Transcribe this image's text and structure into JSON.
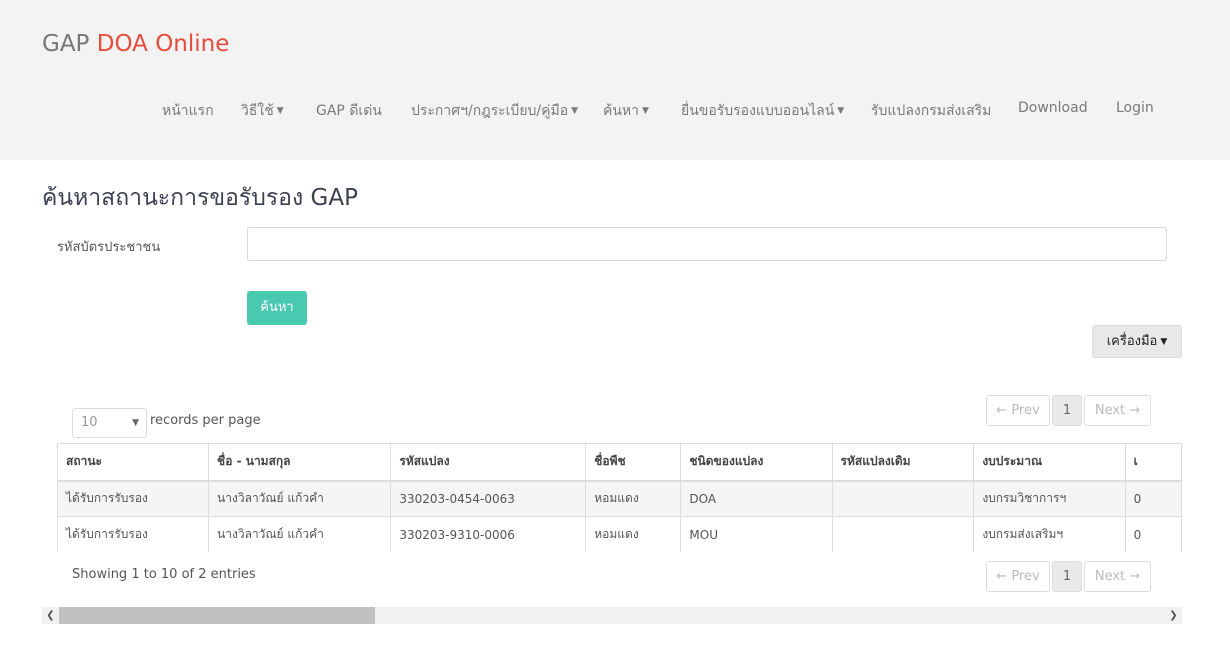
{
  "header": {
    "brand_prefix": "GAP ",
    "brand_accent": "DOA Online",
    "nav": [
      {
        "label": "หน้าแรก",
        "dropdown": false
      },
      {
        "label": "วิธีใช้",
        "dropdown": true
      },
      {
        "label": "GAP ดีเด่น",
        "dropdown": false
      },
      {
        "label": "ประกาศฯ/กฎระเบียบ/คู่มือ",
        "dropdown": true
      },
      {
        "label": "ค้นหา",
        "dropdown": true
      },
      {
        "label": "ยื่นขอรับรองแบบออนไลน์",
        "dropdown": true
      },
      {
        "label": "รับแปลงกรมส่งเสริม",
        "dropdown": false
      },
      {
        "label": "Download",
        "dropdown": false
      },
      {
        "label": "Login",
        "dropdown": false
      }
    ]
  },
  "main": {
    "title": "ค้นหาสถานะการขอรับรอง GAP",
    "id_label": "รหัสบัตรประชาชน",
    "id_value": "",
    "search_button": "ค้นหา",
    "tools_button": "เครื่องมือ"
  },
  "table_controls": {
    "per_page_value": "10",
    "per_page_label": "records per page",
    "prev": "← Prev",
    "page": "1",
    "next": "Next →",
    "showing": "Showing 1 to 10 of 2 entries"
  },
  "table": {
    "columns": [
      "สถานะ",
      "ชื่อ - นามสกุล",
      "รหัสแปลง",
      "ชื่อพืช",
      "ชนิดของแปลง",
      "รหัสแปลงเดิม",
      "งบประมาณ",
      "เ"
    ],
    "rows": [
      [
        "ได้รับการรับรอง",
        "นางวิลาวัณย์ แก้วคำ",
        "330203-0454-0063",
        "หอมแดง",
        "DOA",
        "",
        "งบกรมวิชาการฯ",
        "0"
      ],
      [
        "ได้รับการรับรอง",
        "นางวิลาวัณย์ แก้วคำ",
        "330203-9310-0006",
        "หอมแดง",
        "MOU",
        "",
        "งบกรมส่งเสริมฯ",
        "0"
      ]
    ]
  },
  "colors": {
    "accent_red": "#e74c3c",
    "teal_button": "#48c9b0",
    "header_bg": "#f3f3f3"
  },
  "icons": {
    "caret": "chevron-down-icon",
    "scroll_left": "chevron-left-icon",
    "scroll_right": "chevron-right-icon"
  }
}
